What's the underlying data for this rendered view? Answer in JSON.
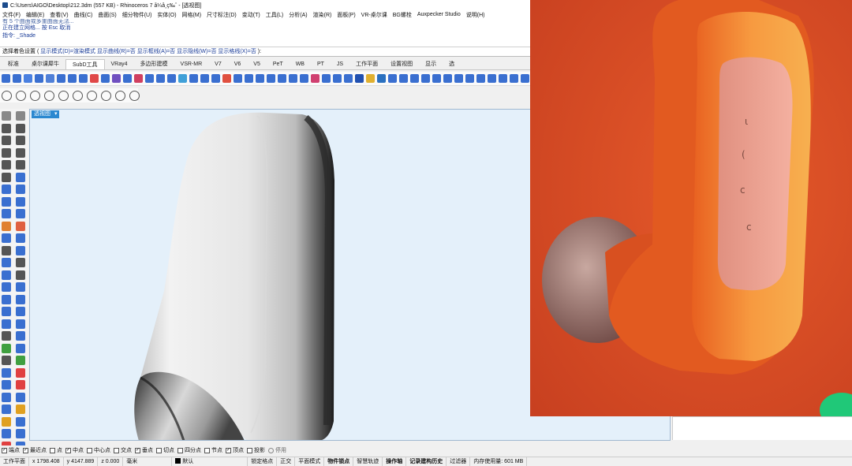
{
  "window": {
    "title": "C:\\Users\\AIGO\\Desktop\\212.3dm (557 KB) - Rhinoceros 7 å¼å¸ç‰ˆ - [透视图]"
  },
  "menu": [
    "文件(F)",
    "编辑(E)",
    "查看(V)",
    "曲线(C)",
    "曲面(S)",
    "细分物件(U)",
    "实体(O)",
    "网格(M)",
    "尺寸标注(D)",
    "变动(T)",
    "工具(L)",
    "分析(A)",
    "渲染(R)",
    "面板(P)",
    "VR-桌尔课",
    "BG螺栓",
    "Auxpecker Studio",
    "说明(H)"
  ],
  "command_history": {
    "faded": "有 5 个曲面或多重曲面无法...",
    "line1": "正在建立网格... 按 Esc 取消",
    "line2": "指令: _Shade"
  },
  "command_prompt": {
    "label": "选择着色设置 (",
    "options": "显示模式(D)=渲染模式 显示曲线(R)=否 显示框线(A)=否 显示隐线(W)=否 显示格线(X)=否",
    "suffix": "):"
  },
  "tabs": [
    "标准",
    "桌尔课犀牛",
    "SubD工具",
    "VRay4",
    "多边形建模",
    "VSR-MR",
    "V7",
    "V6",
    "V5",
    "PeT",
    "WB",
    "PT",
    "JS",
    "工作平面",
    "设置视图",
    "显示",
    "选"
  ],
  "active_tab": "SubD工具",
  "toolbar_colors": [
    "#3a6fd0",
    "#3a6fd0",
    "#4a80e0",
    "#3a6fd0",
    "#5080d8",
    "#3a6fd0",
    "#3a6fd0",
    "#3a6fd0",
    "#e04848",
    "#3a6fd0",
    "#7050c0",
    "#3a6fd0",
    "#d04060",
    "#3a6fd0",
    "#3a6fd0",
    "#3a6fd0",
    "#40a0d8",
    "#3a6fd0",
    "#3a6fd0",
    "#3a6fd0",
    "#e05040",
    "#3a6fd0",
    "#3a6fd0",
    "#3a6fd0",
    "#3a6fd0",
    "#3a6fd0",
    "#3a6fd0",
    "#3a6fd0",
    "#d04070",
    "#3a6fd0",
    "#3a6fd0",
    "#3a6fd0",
    "#2050b0",
    "#e0b030",
    "#2a70c0",
    "#3a6fd0",
    "#3a6fd0",
    "#3a6fd0",
    "#3a6fd0",
    "#3a6fd0",
    "#3a6fd0",
    "#3a6fd0",
    "#3a6fd0",
    "#3a6fd0",
    "#3a6fd0",
    "#3a6fd0",
    "#3a6fd0",
    "#3a6fd0",
    "#3a6fd0",
    "#3a6fd0"
  ],
  "left_toolbar_colors": [
    "#888",
    "#888",
    "#555",
    "#555",
    "#555",
    "#555",
    "#555",
    "#555",
    "#555",
    "#555",
    "#555",
    "#3a6fd0",
    "#3a6fd0",
    "#3a6fd0",
    "#3a6fd0",
    "#3a6fd0",
    "#3a6fd0",
    "#3a6fd0",
    "#e08030",
    "#e06040",
    "#3a6fd0",
    "#3a6fd0",
    "#555",
    "#3a6fd0",
    "#3a6fd0",
    "#555",
    "#3a6fd0",
    "#555",
    "#3a6fd0",
    "#3a6fd0",
    "#3a6fd0",
    "#3a6fd0",
    "#3a6fd0",
    "#3a6fd0",
    "#3a6fd0",
    "#3a6fd0",
    "#555",
    "#3a6fd0",
    "#40a040",
    "#3a6fd0",
    "#555",
    "#40a040",
    "#3a6fd0",
    "#e04040",
    "#3a6fd0",
    "#e04040",
    "#3a6fd0",
    "#3a6fd0",
    "#3a6fd0",
    "#e0a020",
    "#e0a020",
    "#3a6fd0",
    "#3a6fd0",
    "#3a6fd0",
    "#e04040",
    "#3a6fd0"
  ],
  "viewport": {
    "label": "透视图",
    "arrow": "▾"
  },
  "osnaps": [
    {
      "label": "端点",
      "on": true
    },
    {
      "label": "最近点",
      "on": true
    },
    {
      "label": "点",
      "on": false
    },
    {
      "label": "中点",
      "on": true
    },
    {
      "label": "中心点",
      "on": false
    },
    {
      "label": "交点",
      "on": false
    },
    {
      "label": "垂点",
      "on": true
    },
    {
      "label": "切点",
      "on": false
    },
    {
      "label": "四分点",
      "on": false
    },
    {
      "label": "节点",
      "on": false
    },
    {
      "label": "顶点",
      "on": true
    },
    {
      "label": "投影",
      "on": false
    }
  ],
  "osnap_disable": "停用",
  "status": {
    "plane": "工作平面",
    "x": "x 1798.408",
    "y": "y 4147.889",
    "z": "z 0.000",
    "unit": "毫米",
    "layer": "默认",
    "items": [
      "锁定格点",
      "正交",
      "平面模式",
      "物件锁点",
      "智慧轨迹",
      "操作轴",
      "记录建构历史",
      "过滤器",
      "内存使用量: 601 MB"
    ],
    "bold_items": [
      "物件锁点",
      "操作轴",
      "记录建构历史"
    ]
  }
}
